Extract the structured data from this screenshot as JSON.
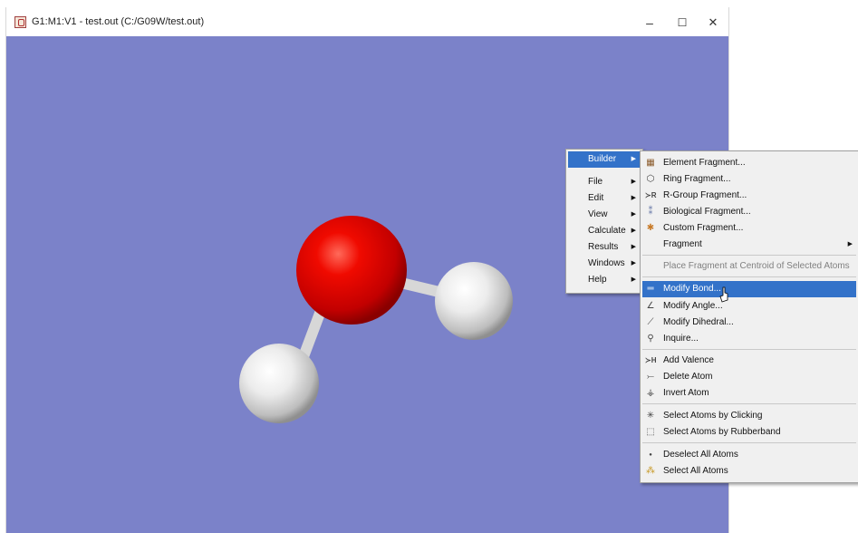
{
  "window": {
    "title": "G1:M1:V1 - test.out (C:/G09W/test.out)",
    "minimize_glyph": "–",
    "maximize_glyph": "☐",
    "close_glyph": "✕"
  },
  "scene": {
    "background_color": "#7b82c9",
    "atoms": [
      {
        "element": "O",
        "color": "#e00000"
      },
      {
        "element": "H",
        "color": "#eeeeee"
      },
      {
        "element": "H",
        "color": "#eeeeee"
      }
    ]
  },
  "main_menu": {
    "items": [
      {
        "label": "Builder",
        "active": true
      },
      {
        "label": "File"
      },
      {
        "label": "Edit"
      },
      {
        "label": "View"
      },
      {
        "label": "Calculate"
      },
      {
        "label": "Results"
      },
      {
        "label": "Windows"
      },
      {
        "label": "Help"
      }
    ]
  },
  "builder_menu": {
    "items": [
      {
        "label": "Element Fragment...",
        "icon": "element-fragment-icon"
      },
      {
        "label": "Ring Fragment...",
        "icon": "ring-fragment-icon"
      },
      {
        "label": "R-Group Fragment...",
        "icon": "r-group-icon"
      },
      {
        "label": "Biological Fragment...",
        "icon": "biological-fragment-icon"
      },
      {
        "label": "Custom Fragment...",
        "icon": "custom-fragment-icon"
      },
      {
        "label": "Fragment",
        "icon": "none"
      },
      {
        "label": "Place Fragment at Centroid of Selected Atoms",
        "icon": "none",
        "disabled": true
      },
      {
        "label": "Modify Bond...",
        "icon": "bond-icon",
        "active": true
      },
      {
        "label": "Modify Angle...",
        "icon": "angle-icon"
      },
      {
        "label": "Modify Dihedral...",
        "icon": "dihedral-icon"
      },
      {
        "label": "Inquire...",
        "icon": "inquire-icon"
      },
      {
        "label": "Add Valence",
        "icon": "add-valence-icon"
      },
      {
        "label": "Delete Atom",
        "icon": "delete-atom-icon"
      },
      {
        "label": "Invert Atom",
        "icon": "invert-atom-icon"
      },
      {
        "label": "Select Atoms by Clicking",
        "icon": "select-click-icon"
      },
      {
        "label": "Select Atoms by Rubberband",
        "icon": "select-rubberband-icon"
      },
      {
        "label": "Deselect All Atoms",
        "icon": "deselect-icon"
      },
      {
        "label": "Select All Atoms",
        "icon": "select-all-icon"
      }
    ]
  }
}
